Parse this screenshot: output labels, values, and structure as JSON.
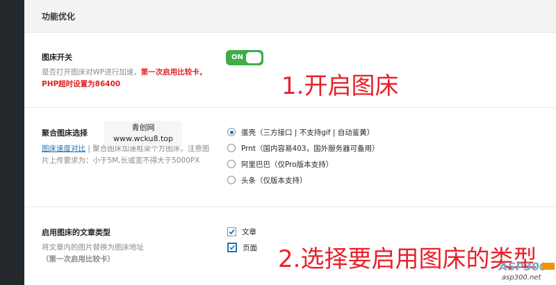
{
  "section": {
    "title": "功能优化"
  },
  "image_hosting_switch": {
    "label": "图床开关",
    "desc_prefix": "是否打开图床对WP进行加速，",
    "desc_red": "第一次启用比较卡，PHP超时设置为86400",
    "toggle_text": "ON",
    "enabled": true
  },
  "annotation_1": "1.开启图床",
  "aggregate_hosting": {
    "label": "聚合图床选择",
    "link_text": "图床速度对比",
    "desc_rest": " | 聚合图床加速框架个方图床，注意图片上传要求为：小于5M,长或宽不得大于5000PX",
    "options": [
      {
        "label": "蛋壳（三方接口 | 不支持gif | 自动鉴黄）",
        "checked": true
      },
      {
        "label": "Prnt（国内容易403，国外服务器可备用）",
        "checked": false
      },
      {
        "label": "阿里巴巴（仅Pro版本支持）",
        "checked": false
      },
      {
        "label": "头条（仅版本支持）",
        "checked": false
      }
    ]
  },
  "watermark": {
    "line1": "青创网",
    "line2": "www.wcku8.top"
  },
  "post_types": {
    "label": "启用图床的文章类型",
    "desc_prefix": "将文章内的图片替换为图床地址",
    "desc_bold": "（第一次启用比较卡）",
    "options": [
      {
        "label": "文章",
        "checked": true
      },
      {
        "label": "页面",
        "checked": true
      }
    ]
  },
  "annotation_2": "2.选择要启用图床的类型",
  "site_logo": {
    "main": "ASP300",
    "sub": "asp300.net"
  }
}
